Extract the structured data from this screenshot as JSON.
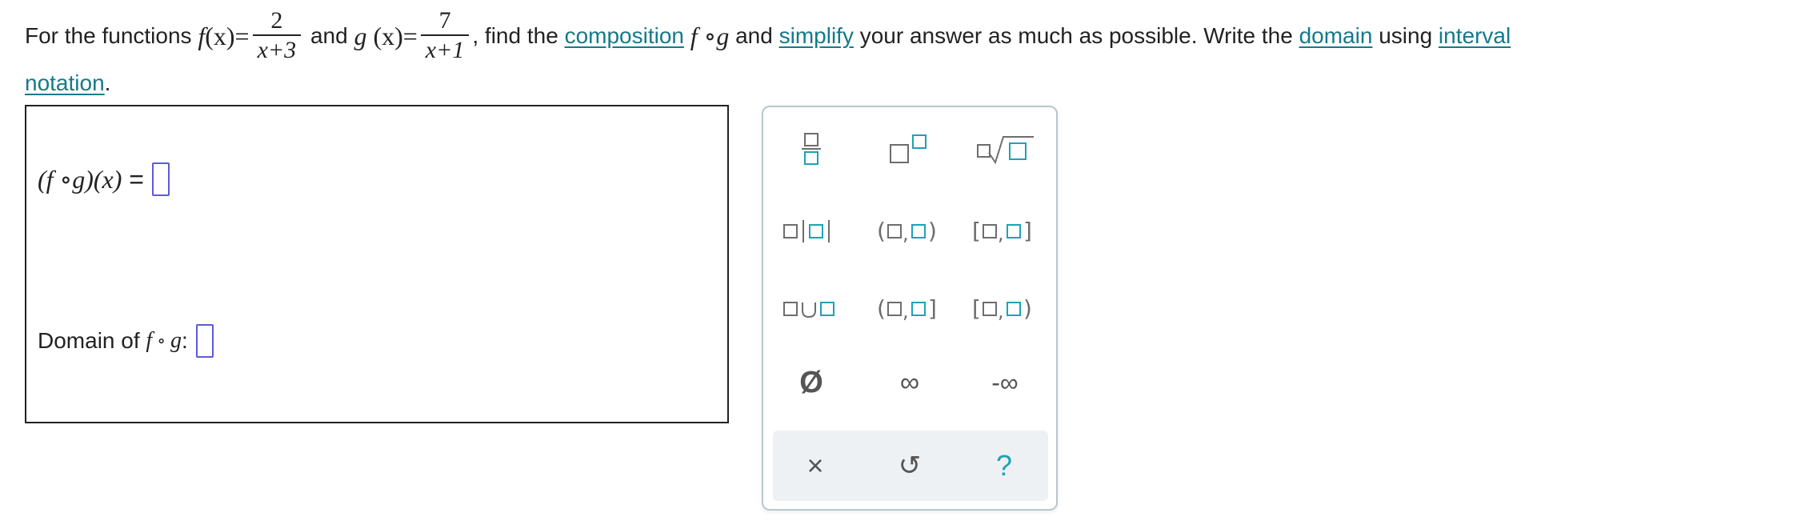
{
  "question": {
    "prefix": "For the functions",
    "f_name": "f",
    "paren_x_f": "(x)",
    "f_numerator": "2",
    "f_denominator": "x+3",
    "and": "and",
    "g_name": "g",
    "paren_x_g": "(x)",
    "g_numerator": "7",
    "g_denominator": "x+1",
    "comma": ",",
    "find_the": "find the",
    "composition_link": "composition",
    "fog": "f ∘g",
    "and2": "and",
    "simplify_link": "simplify",
    "mid_text": "your answer as much as possible. Write the",
    "domain_link": "domain",
    "using": "using",
    "interval_link": "interval",
    "notation_link": "notation",
    "period": "."
  },
  "answer": {
    "composition_label": "(f ∘g)(x)",
    "equals": "=",
    "composition_value": "",
    "domain_label": "Domain of",
    "domain_f": "f",
    "domain_ring": "∘",
    "domain_g": "g",
    "domain_colon": ":",
    "domain_value": ""
  },
  "keypad": {
    "row1": [
      "fraction-key",
      "exponent-key",
      "nth-root-key"
    ],
    "union": "∪",
    "empty_set": "Ø",
    "infinity": "∞",
    "neg_infinity": "-∞",
    "clear": "×",
    "undo": "↺",
    "help": "?",
    "accent_color": "#1ea2b6",
    "link_color": "#137a8b",
    "input_border_color": "#5b5bd6"
  }
}
